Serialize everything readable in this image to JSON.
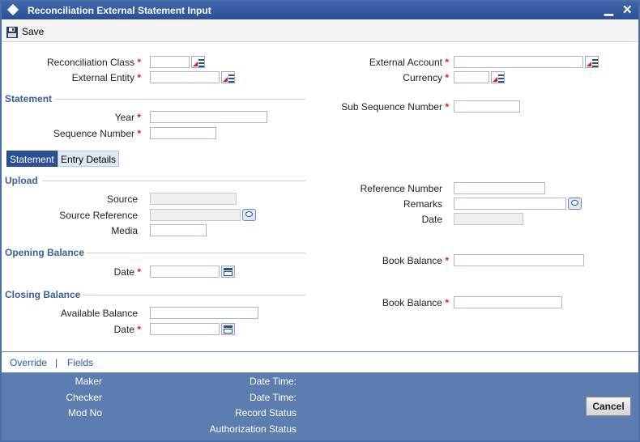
{
  "window": {
    "title": "Reconciliation External Statement Input",
    "minimize_glyph": "▁",
    "close_glyph": "✕"
  },
  "toolbar": {
    "save_label": "Save"
  },
  "fields": {
    "reconciliation_class": {
      "label": "Reconciliation Class",
      "value": ""
    },
    "external_entity": {
      "label": "External Entity",
      "value": ""
    },
    "external_account": {
      "label": "External Account",
      "value": ""
    },
    "currency": {
      "label": "Currency",
      "value": ""
    },
    "year": {
      "label": "Year",
      "value": ""
    },
    "sequence_number": {
      "label": "Sequence Number",
      "value": ""
    },
    "sub_sequence_number": {
      "label": "Sub Sequence Number",
      "value": ""
    },
    "source": {
      "label": "Source",
      "value": ""
    },
    "source_reference": {
      "label": "Source Reference",
      "value": ""
    },
    "media": {
      "label": "Media",
      "value": ""
    },
    "reference_number": {
      "label": "Reference Number",
      "value": ""
    },
    "remarks": {
      "label": "Remarks",
      "value": ""
    },
    "upload_date": {
      "label": "Date",
      "value": ""
    },
    "opening_date": {
      "label": "Date",
      "value": ""
    },
    "opening_book_balance": {
      "label": "Book Balance",
      "value": ""
    },
    "available_balance": {
      "label": "Available Balance",
      "value": ""
    },
    "closing_date": {
      "label": "Date",
      "value": ""
    },
    "closing_book_balance": {
      "label": "Book Balance",
      "value": ""
    }
  },
  "sections": {
    "statement": "Statement",
    "upload": "Upload",
    "opening_balance": "Opening Balance",
    "closing_balance": "Closing Balance"
  },
  "tabs": [
    {
      "label": "Statement",
      "active": true
    },
    {
      "label": "Entry Details",
      "active": false
    }
  ],
  "required_marker": "*",
  "links": {
    "override": "Override",
    "separator": "|",
    "fields": "Fields"
  },
  "audit": {
    "maker": "Maker",
    "checker": "Checker",
    "mod_no": "Mod No",
    "date_time_1": "Date Time:",
    "date_time_2": "Date Time:",
    "record_status": "Record Status",
    "authorization_status": "Authorization Status"
  },
  "buttons": {
    "cancel": "Cancel"
  },
  "colors": {
    "title_bar": "#2b4f94",
    "section_text": "#3b5f98",
    "required": "#d62020",
    "footer": "#5d7db0",
    "link": "#2b5aa8"
  }
}
